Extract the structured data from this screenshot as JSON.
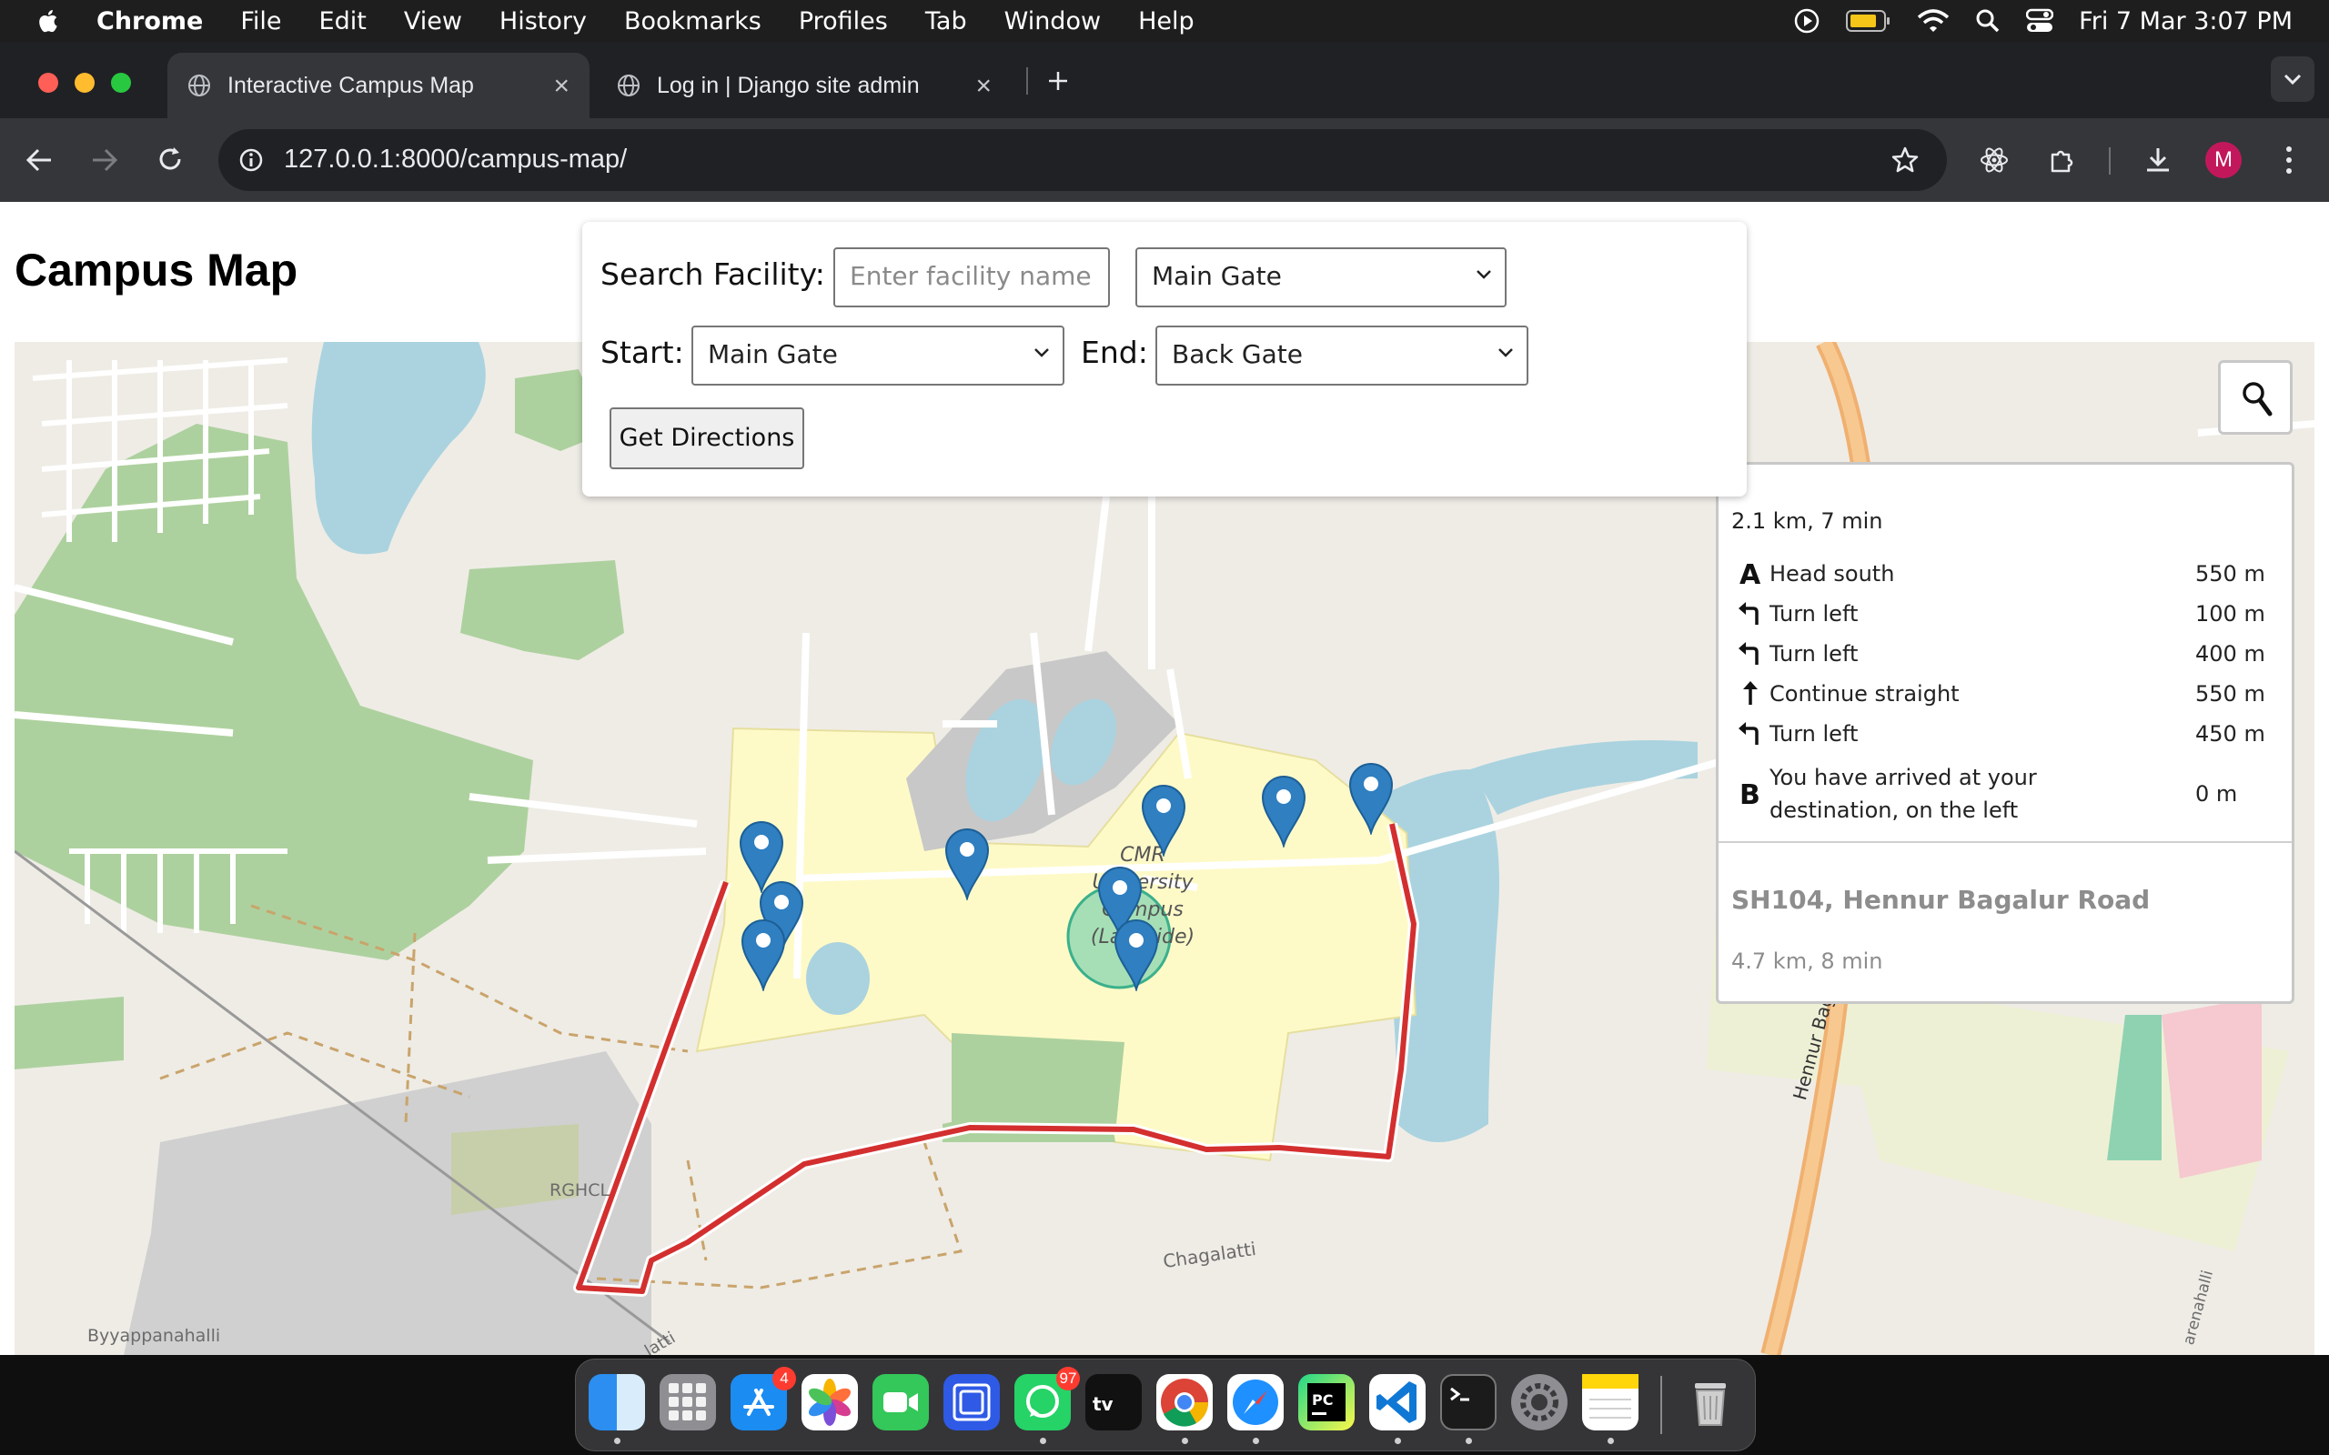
{
  "menubar": {
    "app_name": "Chrome",
    "menus": [
      "File",
      "Edit",
      "View",
      "History",
      "Bookmarks",
      "Profiles",
      "Tab",
      "Window",
      "Help"
    ],
    "clock": "Fri 7 Mar  3:07 PM"
  },
  "browser": {
    "tabs": [
      {
        "title": "Interactive Campus Map"
      },
      {
        "title": "Log in | Django site admin"
      }
    ],
    "url": "127.0.0.1:8000/campus-map/",
    "profile_initial": "M"
  },
  "page": {
    "title": "Campus Map",
    "search": {
      "label": "Search Facility:",
      "placeholder": "Enter facility name",
      "selected_facility": "Main Gate"
    },
    "route": {
      "start_label": "Start:",
      "start_value": "Main Gate",
      "end_label": "End:",
      "end_value": "Back Gate",
      "button_label": "Get Directions"
    }
  },
  "map": {
    "labels": {
      "campus": "CMR University Campus (Lakeside)",
      "campus_lines": [
        "CMR University",
        "Campus",
        "(Lakeside)"
      ],
      "rghcl": "RGHCL",
      "chagalatti": "Chagalatti",
      "byyappanahalli": "Byyappanahalli",
      "road": "Hennur Bagalur Road",
      "latti": "latti",
      "edge": "arenahalli"
    },
    "route_color": "#d32f2f",
    "marker_color": "#2f7fc1"
  },
  "routing": {
    "summary": "2.1 km, 7 min",
    "steps": [
      {
        "icon": "start-A",
        "text": "Head south",
        "distance": "550 m"
      },
      {
        "icon": "turn-left",
        "text": "Turn left",
        "distance": "100 m"
      },
      {
        "icon": "turn-left",
        "text": "Turn left",
        "distance": "400 m"
      },
      {
        "icon": "continue-straight",
        "text": "Continue straight",
        "distance": "550 m"
      },
      {
        "icon": "turn-left",
        "text": "Turn left",
        "distance": "450 m"
      },
      {
        "icon": "end-B",
        "text": "You have arrived at your destination, on the left",
        "distance": "0 m"
      }
    ],
    "alternative": {
      "name": "SH104, Hennur Bagalur Road",
      "summary": "4.7 km, 8 min"
    }
  },
  "dock": {
    "apps": [
      "Finder",
      "Launchpad",
      "App Store",
      "Photos",
      "FaceTime",
      "Screen Sharing",
      "WhatsApp",
      "Apple TV",
      "Chrome",
      "Safari",
      "PyCharm",
      "Visual Studio Code",
      "Terminal",
      "System Settings",
      "Notes",
      "Trash"
    ],
    "badges": {
      "App Store": "4",
      "WhatsApp": "97"
    }
  }
}
